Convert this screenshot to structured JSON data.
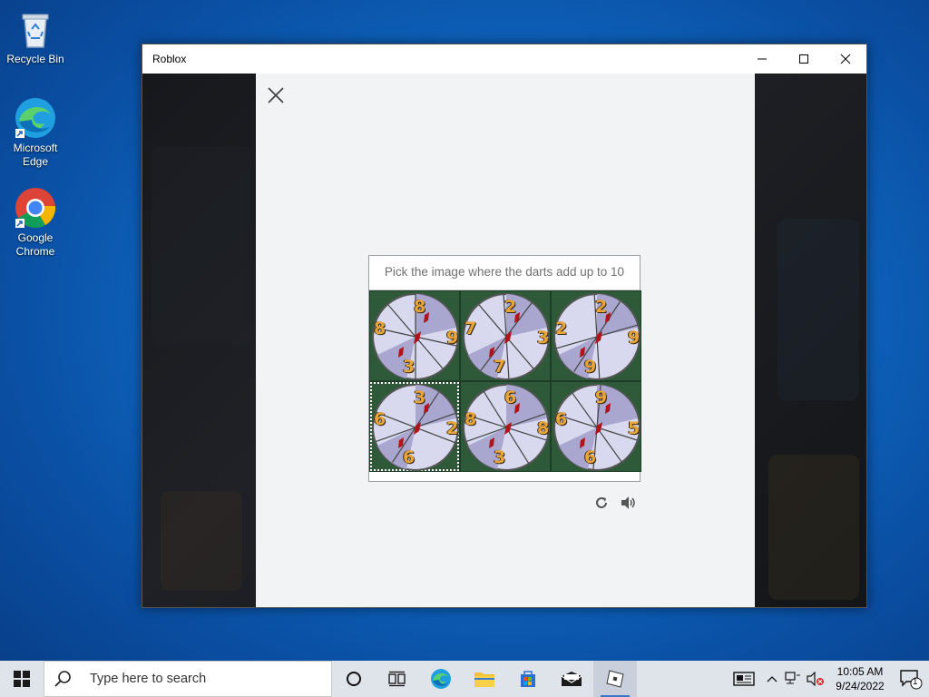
{
  "desktop": {
    "icons": [
      {
        "label": "Recycle Bin",
        "icon": "recycle-bin-icon"
      },
      {
        "label": "Microsoft Edge",
        "icon": "edge-icon"
      },
      {
        "label": "Google Chrome",
        "icon": "chrome-icon"
      }
    ]
  },
  "window": {
    "title": "Roblox",
    "minimize": "minimize",
    "maximize": "maximize",
    "close": "close"
  },
  "captcha": {
    "prompt": "Pick the image where the darts add up to 10",
    "tiles": [
      {
        "numbers": [
          "8",
          "8",
          "9",
          "3"
        ],
        "selected": false
      },
      {
        "numbers": [
          "2",
          "7",
          "3",
          "7"
        ],
        "selected": false
      },
      {
        "numbers": [
          "2",
          "2",
          "9",
          "9"
        ],
        "selected": false
      },
      {
        "numbers": [
          "3",
          "6",
          "2",
          "6"
        ],
        "selected": true
      },
      {
        "numbers": [
          "6",
          "8",
          "8",
          "3"
        ],
        "selected": false
      },
      {
        "numbers": [
          "9",
          "6",
          "5",
          "6"
        ],
        "selected": false
      }
    ],
    "refresh_icon": "refresh-icon",
    "audio_icon": "speaker-icon"
  },
  "taskbar": {
    "search_placeholder": "Type here to search",
    "time": "10:05 AM",
    "date": "9/24/2022",
    "notification_count": "1"
  }
}
